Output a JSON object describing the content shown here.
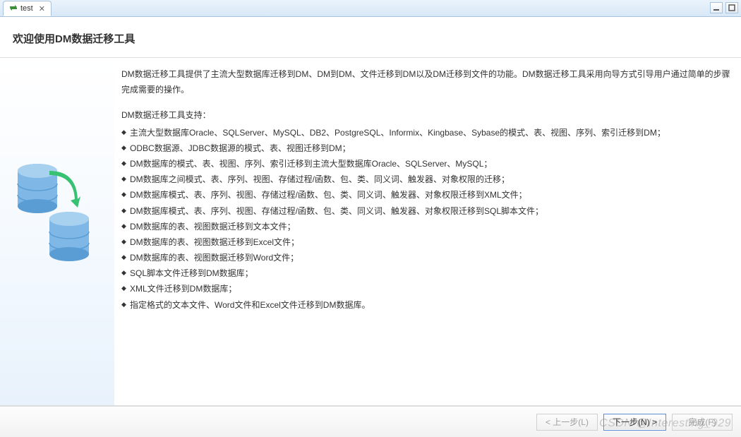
{
  "tab": {
    "label": "test",
    "icon_name": "transfer-icon"
  },
  "page_title": "欢迎使用DM数据迁移工具",
  "intro": "DM数据迁移工具提供了主流大型数据库迁移到DM、DM到DM、文件迁移到DM以及DM迁移到文件的功能。DM数据迁移工具采用向导方式引导用户通过简单的步骤完成需要的操作。",
  "support_title": "DM数据迁移工具支持：",
  "features": [
    "主流大型数据库Oracle、SQLServer、MySQL、DB2、PostgreSQL、Informix、Kingbase、Sybase的模式、表、视图、序列、索引迁移到DM；",
    "ODBC数据源、JDBC数据源的模式、表、视图迁移到DM；",
    "DM数据库的模式、表、视图、序列、索引迁移到主流大型数据库Oracle、SQLServer、MySQL；",
    "DM数据库之间模式、表、序列、视图、存储过程/函数、包、类、同义词、触发器、对象权限的迁移；",
    "DM数据库模式、表、序列、视图、存储过程/函数、包、类、同义词、触发器、对象权限迁移到XML文件；",
    "DM数据库模式、表、序列、视图、存储过程/函数、包、类、同义词、触发器、对象权限迁移到SQL脚本文件；",
    "DM数据库的表、视图数据迁移到文本文件；",
    "DM数据库的表、视图数据迁移到Excel文件；",
    "DM数据库的表、视图数据迁移到Word文件；",
    "SQL脚本文件迁移到DM数据库；",
    "XML文件迁移到DM数据库；",
    "指定格式的文本文件、Word文件和Excel文件迁移到DM数据库。"
  ],
  "buttons": {
    "prev": "< 上一步(L)",
    "next": "下一步(N) >",
    "finish": "完成(F)"
  },
  "watermark": "CSDN @Interesting_929"
}
